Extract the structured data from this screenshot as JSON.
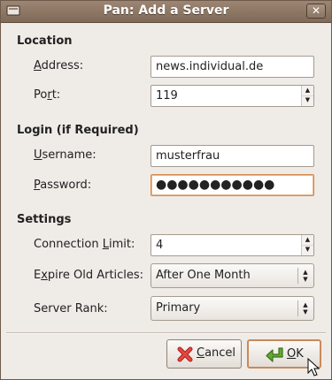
{
  "window": {
    "title": "Pan: Add a Server",
    "close_glyph": "✕"
  },
  "location": {
    "heading": "Location",
    "address": {
      "label_mnemonic": "A",
      "label_rest": "ddress:",
      "value": "news.individual.de"
    },
    "port": {
      "label_pre": "Po",
      "label_mnemonic": "r",
      "label_rest": "t:",
      "value": "119"
    }
  },
  "login": {
    "heading": "Login (if Required)",
    "username": {
      "label_mnemonic": "U",
      "label_rest": "sername:",
      "value": "musterfrau"
    },
    "password": {
      "label_mnemonic": "P",
      "label_rest": "assword:",
      "masked_value": "●●●●●●●●●●●"
    }
  },
  "settings": {
    "heading": "Settings",
    "connection_limit": {
      "label_pre": "Connection ",
      "label_mnemonic": "L",
      "label_rest": "imit:",
      "value": "4"
    },
    "expire": {
      "label_pre": "E",
      "label_mnemonic": "x",
      "label_rest": "pire Old Articles:",
      "selected": "After One Month"
    },
    "server_rank": {
      "label": "Server Rank:",
      "selected": "Primary"
    }
  },
  "buttons": {
    "cancel": {
      "label_mnemonic": "C",
      "label_rest": "ancel",
      "icon": "cancel-x-icon"
    },
    "ok": {
      "label_mnemonic": "O",
      "label_rest": "K",
      "icon": "ok-arrow-icon"
    }
  },
  "colors": {
    "titlebar": "#8a7561",
    "focus_border": "#d58a4d",
    "cancel_icon": "#d9302b",
    "ok_icon": "#5aa02c"
  }
}
